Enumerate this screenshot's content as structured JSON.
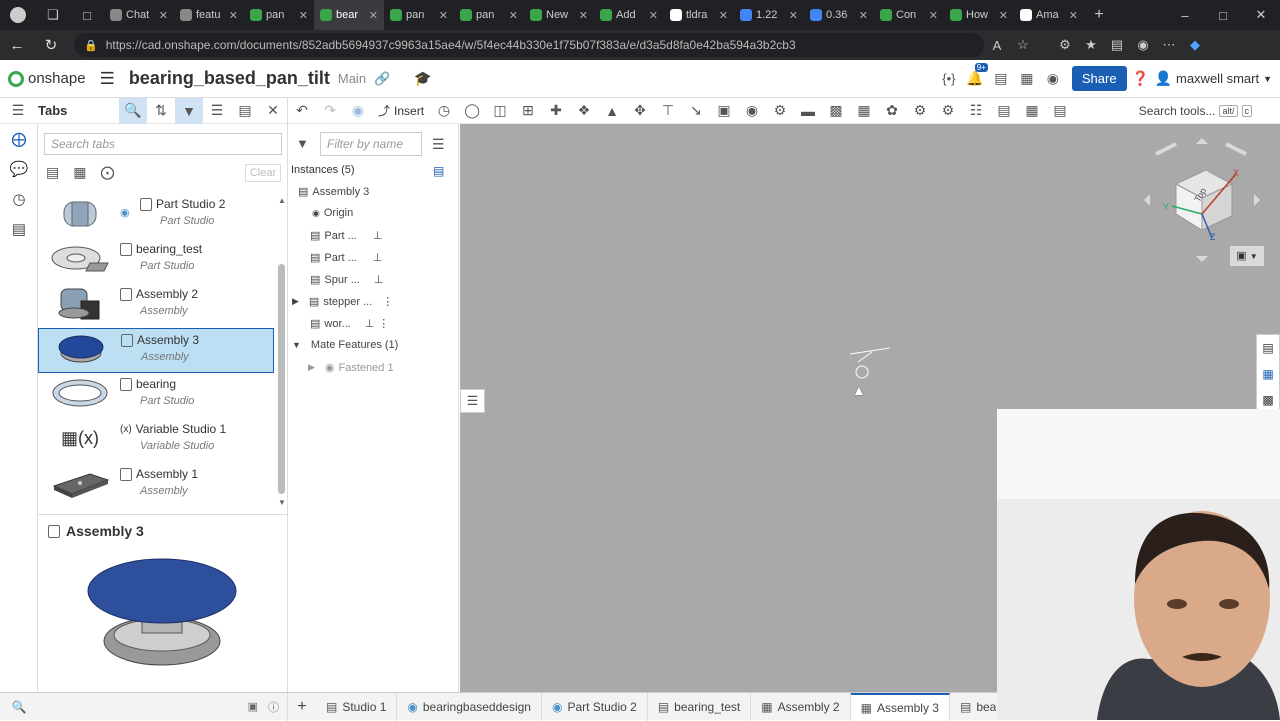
{
  "browser": {
    "tabs": [
      {
        "label": "Chat",
        "color": "#888888"
      },
      {
        "label": "featu",
        "color": "#888888"
      },
      {
        "label": "pan",
        "color": "#3aa54a"
      },
      {
        "label": "bear",
        "color": "#3aa54a",
        "active": true
      },
      {
        "label": "pan",
        "color": "#3aa54a"
      },
      {
        "label": "pan",
        "color": "#3aa54a"
      },
      {
        "label": "New",
        "color": "#3aa54a"
      },
      {
        "label": "Add",
        "color": "#3aa54a"
      },
      {
        "label": "tldra",
        "color": "#ffffff"
      },
      {
        "label": "1.22",
        "color": "#4285f4"
      },
      {
        "label": "0.36",
        "color": "#4285f4"
      },
      {
        "label": "Con",
        "color": "#3aa54a"
      },
      {
        "label": "How",
        "color": "#3aa54a"
      },
      {
        "label": "Ama",
        "color": "#ffffff"
      }
    ],
    "url": "https://cad.onshape.com/documents/852adb5694937c9963a15ae4/w/5f4ec44b330e1f75b07f383a/e/d3a5d8fa0e42ba594a3b2cb3"
  },
  "header": {
    "logo_text": "onshape",
    "document_title": "bearing_based_pan_tilt",
    "branch": "Main",
    "notification_count": "9+",
    "share_label": "Share",
    "user_name": "maxwell smart"
  },
  "toolbar": {
    "insert_label": "Insert",
    "search_tools_label": "Search tools...",
    "search_tools_shortcut": "alt/",
    "search_tools_shortcut2": "c"
  },
  "tabs_panel": {
    "title": "Tabs",
    "search_placeholder": "Search tabs",
    "clear_label": "Clear",
    "items": [
      {
        "name": "Part Studio 2",
        "type": "Part Studio"
      },
      {
        "name": "bearing_test",
        "type": "Part Studio"
      },
      {
        "name": "Assembly 2",
        "type": "Assembly"
      },
      {
        "name": "Assembly 3",
        "type": "Assembly",
        "selected": true
      },
      {
        "name": "bearing",
        "type": "Part Studio"
      },
      {
        "name": "Variable Studio 1",
        "type": "Variable Studio"
      },
      {
        "name": "Assembly 1",
        "type": "Assembly"
      }
    ],
    "preview_title": "Assembly 3"
  },
  "feature_panel": {
    "filter_placeholder": "Filter by name",
    "instances_label": "Instances (5)",
    "assembly_name": "Assembly 3",
    "items": [
      "Origin",
      "Part ...",
      "Part ...",
      "Spur ...",
      "stepper ...",
      "wor..."
    ],
    "mate_features_label": "Mate Features (1)",
    "mate_items": [
      "Fastened 1"
    ]
  },
  "viewcube": {
    "face_label": "Top",
    "axis_x": "X",
    "axis_y": "Y",
    "axis_z": "Z"
  },
  "bottom_tabs": [
    {
      "label": "Studio 1",
      "kind": "partstudio"
    },
    {
      "label": "bearingbaseddesign",
      "kind": "linked"
    },
    {
      "label": "Part Studio 2",
      "kind": "linked"
    },
    {
      "label": "bearing_test",
      "kind": "partstudio"
    },
    {
      "label": "Assembly 2",
      "kind": "assembly"
    },
    {
      "label": "Assembly 3",
      "kind": "assembly",
      "active": true
    },
    {
      "label": "bearir",
      "kind": "partstudio"
    }
  ]
}
